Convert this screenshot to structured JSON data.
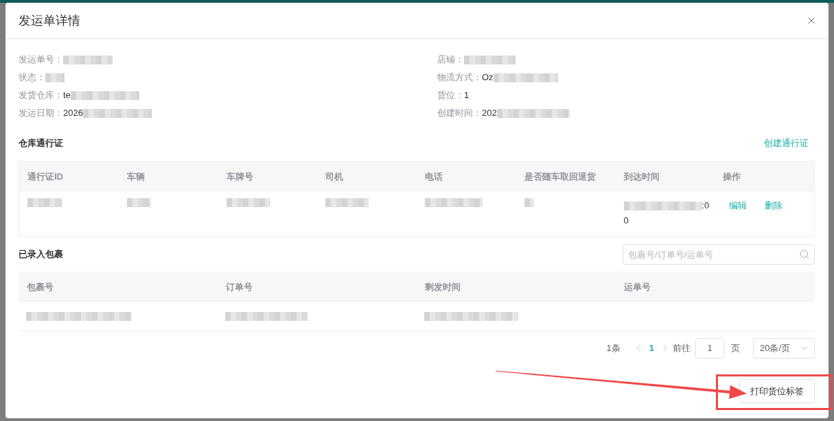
{
  "dialog": {
    "title": "发运单详情"
  },
  "info": {
    "columns": [
      [
        {
          "label": "发运单号：",
          "value": [
            {
              "kind": "blur"
            }
          ]
        },
        {
          "label": "状态：",
          "value": [
            {
              "kind": "blur"
            }
          ]
        },
        {
          "label": "发货仓库：",
          "value": [
            {
              "kind": "text",
              "text": "te"
            },
            {
              "kind": "blur"
            }
          ]
        },
        {
          "label": "发运日期：",
          "value": [
            {
              "kind": "text",
              "text": "2026"
            },
            {
              "kind": "blur"
            }
          ]
        }
      ],
      [
        {
          "label": "店铺：",
          "value": [
            {
              "kind": "blur"
            }
          ]
        },
        {
          "label": "物流方式：",
          "value": [
            {
              "kind": "text",
              "text": "Oz"
            },
            {
              "kind": "blur"
            },
            {
              "kind": "blur"
            }
          ]
        },
        {
          "label": "货位：",
          "value": [
            {
              "kind": "text",
              "text": "1"
            }
          ]
        },
        {
          "label": "创建时间：",
          "value": [
            {
              "kind": "text",
              "text": "202"
            },
            {
              "kind": "blur"
            }
          ]
        }
      ]
    ]
  },
  "passes": {
    "title": "仓库通行证",
    "create_link": "创建通行证",
    "columns": [
      "通行证ID",
      "车辆",
      "车牌号",
      "司机",
      "电话",
      "是否随车取回退货",
      "到达时间",
      "操作"
    ],
    "rows": [
      {
        "cells": [
          [
            {
              "kind": "blur"
            }
          ],
          [
            {
              "kind": "blur"
            }
          ],
          [
            {
              "kind": "blur"
            }
          ],
          [
            {
              "kind": "blur"
            }
          ],
          [
            {
              "kind": "blur"
            }
          ],
          [
            {
              "kind": "blur"
            }
          ],
          [
            {
              "kind": "blur"
            },
            {
              "kind": "text",
              "text": ":0"
            },
            {
              "kind": "break"
            },
            {
              "kind": "text",
              "text": "0"
            }
          ]
        ],
        "actions": [
          "编辑",
          "删除"
        ]
      }
    ]
  },
  "parcels": {
    "title": "已录入包裹",
    "search": {
      "placeholder": "包裹号/订单号/运单号"
    },
    "columns": [
      "包裹号",
      "订单号",
      "剩发时间",
      "运单号"
    ],
    "rows": [
      {
        "cells": [
          [
            {
              "kind": "blur"
            }
          ],
          [
            {
              "kind": "blur"
            }
          ],
          [
            {
              "kind": "blur"
            }
          ]
        ]
      }
    ],
    "pagination": {
      "total": "1条",
      "pages": [
        {
          "label": "1",
          "selected": true
        }
      ],
      "goto_label": "前往",
      "goto_value": "1",
      "page_unit": "页",
      "page_size": "20条/页"
    }
  },
  "footer": {
    "buttons": [
      {
        "label": "打印货位标签",
        "annotated": true
      }
    ]
  }
}
